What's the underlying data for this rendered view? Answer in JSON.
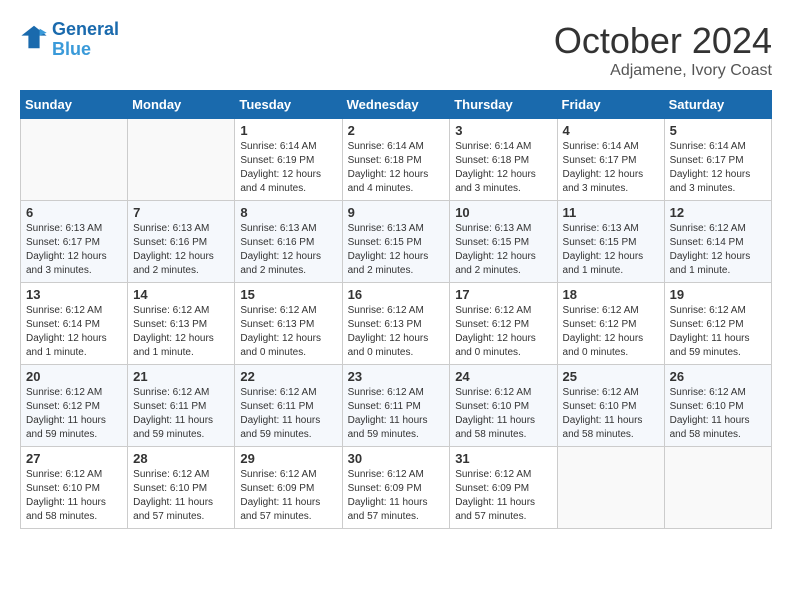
{
  "header": {
    "logo_line1": "General",
    "logo_line2": "Blue",
    "month": "October 2024",
    "location": "Adjamene, Ivory Coast"
  },
  "weekdays": [
    "Sunday",
    "Monday",
    "Tuesday",
    "Wednesday",
    "Thursday",
    "Friday",
    "Saturday"
  ],
  "weeks": [
    [
      {
        "day": "",
        "info": ""
      },
      {
        "day": "",
        "info": ""
      },
      {
        "day": "1",
        "info": "Sunrise: 6:14 AM\nSunset: 6:19 PM\nDaylight: 12 hours\nand 4 minutes."
      },
      {
        "day": "2",
        "info": "Sunrise: 6:14 AM\nSunset: 6:18 PM\nDaylight: 12 hours\nand 4 minutes."
      },
      {
        "day": "3",
        "info": "Sunrise: 6:14 AM\nSunset: 6:18 PM\nDaylight: 12 hours\nand 3 minutes."
      },
      {
        "day": "4",
        "info": "Sunrise: 6:14 AM\nSunset: 6:17 PM\nDaylight: 12 hours\nand 3 minutes."
      },
      {
        "day": "5",
        "info": "Sunrise: 6:14 AM\nSunset: 6:17 PM\nDaylight: 12 hours\nand 3 minutes."
      }
    ],
    [
      {
        "day": "6",
        "info": "Sunrise: 6:13 AM\nSunset: 6:17 PM\nDaylight: 12 hours\nand 3 minutes."
      },
      {
        "day": "7",
        "info": "Sunrise: 6:13 AM\nSunset: 6:16 PM\nDaylight: 12 hours\nand 2 minutes."
      },
      {
        "day": "8",
        "info": "Sunrise: 6:13 AM\nSunset: 6:16 PM\nDaylight: 12 hours\nand 2 minutes."
      },
      {
        "day": "9",
        "info": "Sunrise: 6:13 AM\nSunset: 6:15 PM\nDaylight: 12 hours\nand 2 minutes."
      },
      {
        "day": "10",
        "info": "Sunrise: 6:13 AM\nSunset: 6:15 PM\nDaylight: 12 hours\nand 2 minutes."
      },
      {
        "day": "11",
        "info": "Sunrise: 6:13 AM\nSunset: 6:15 PM\nDaylight: 12 hours\nand 1 minute."
      },
      {
        "day": "12",
        "info": "Sunrise: 6:12 AM\nSunset: 6:14 PM\nDaylight: 12 hours\nand 1 minute."
      }
    ],
    [
      {
        "day": "13",
        "info": "Sunrise: 6:12 AM\nSunset: 6:14 PM\nDaylight: 12 hours\nand 1 minute."
      },
      {
        "day": "14",
        "info": "Sunrise: 6:12 AM\nSunset: 6:13 PM\nDaylight: 12 hours\nand 1 minute."
      },
      {
        "day": "15",
        "info": "Sunrise: 6:12 AM\nSunset: 6:13 PM\nDaylight: 12 hours\nand 0 minutes."
      },
      {
        "day": "16",
        "info": "Sunrise: 6:12 AM\nSunset: 6:13 PM\nDaylight: 12 hours\nand 0 minutes."
      },
      {
        "day": "17",
        "info": "Sunrise: 6:12 AM\nSunset: 6:12 PM\nDaylight: 12 hours\nand 0 minutes."
      },
      {
        "day": "18",
        "info": "Sunrise: 6:12 AM\nSunset: 6:12 PM\nDaylight: 12 hours\nand 0 minutes."
      },
      {
        "day": "19",
        "info": "Sunrise: 6:12 AM\nSunset: 6:12 PM\nDaylight: 11 hours\nand 59 minutes."
      }
    ],
    [
      {
        "day": "20",
        "info": "Sunrise: 6:12 AM\nSunset: 6:12 PM\nDaylight: 11 hours\nand 59 minutes."
      },
      {
        "day": "21",
        "info": "Sunrise: 6:12 AM\nSunset: 6:11 PM\nDaylight: 11 hours\nand 59 minutes."
      },
      {
        "day": "22",
        "info": "Sunrise: 6:12 AM\nSunset: 6:11 PM\nDaylight: 11 hours\nand 59 minutes."
      },
      {
        "day": "23",
        "info": "Sunrise: 6:12 AM\nSunset: 6:11 PM\nDaylight: 11 hours\nand 59 minutes."
      },
      {
        "day": "24",
        "info": "Sunrise: 6:12 AM\nSunset: 6:10 PM\nDaylight: 11 hours\nand 58 minutes."
      },
      {
        "day": "25",
        "info": "Sunrise: 6:12 AM\nSunset: 6:10 PM\nDaylight: 11 hours\nand 58 minutes."
      },
      {
        "day": "26",
        "info": "Sunrise: 6:12 AM\nSunset: 6:10 PM\nDaylight: 11 hours\nand 58 minutes."
      }
    ],
    [
      {
        "day": "27",
        "info": "Sunrise: 6:12 AM\nSunset: 6:10 PM\nDaylight: 11 hours\nand 58 minutes."
      },
      {
        "day": "28",
        "info": "Sunrise: 6:12 AM\nSunset: 6:10 PM\nDaylight: 11 hours\nand 57 minutes."
      },
      {
        "day": "29",
        "info": "Sunrise: 6:12 AM\nSunset: 6:09 PM\nDaylight: 11 hours\nand 57 minutes."
      },
      {
        "day": "30",
        "info": "Sunrise: 6:12 AM\nSunset: 6:09 PM\nDaylight: 11 hours\nand 57 minutes."
      },
      {
        "day": "31",
        "info": "Sunrise: 6:12 AM\nSunset: 6:09 PM\nDaylight: 11 hours\nand 57 minutes."
      },
      {
        "day": "",
        "info": ""
      },
      {
        "day": "",
        "info": ""
      }
    ]
  ]
}
